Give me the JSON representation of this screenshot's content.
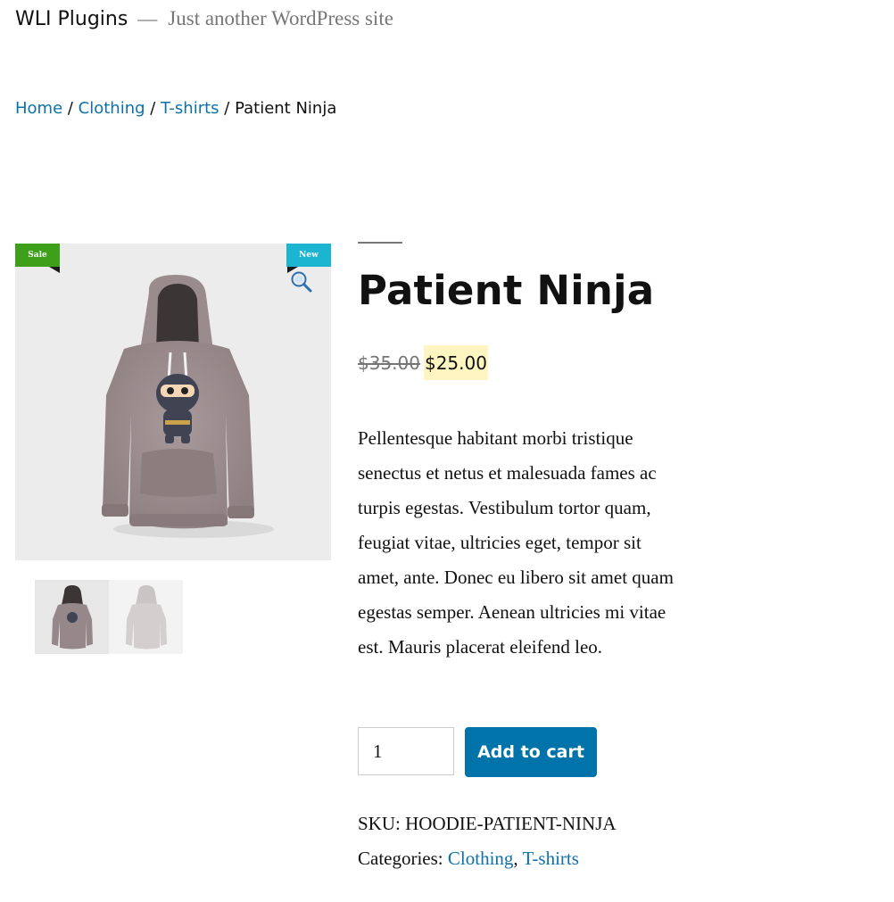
{
  "site": {
    "title": "WLI Plugins",
    "separator": "—",
    "tagline": "Just another WordPress site"
  },
  "breadcrumb": {
    "home": "Home",
    "sep1": " / ",
    "clothing": "Clothing",
    "sep2": " / ",
    "tshirts": "T-shirts",
    "sep3": " / ",
    "current": "Patient Ninja"
  },
  "gallery": {
    "badge_sale": "Sale",
    "badge_new": "New",
    "badge_sale_color": "#3d9f1a",
    "badge_new_color": "#1bb4d1",
    "zoom_icon": "search-zoom-icon",
    "thumbnails": [
      "hoodie-front-thumbnail",
      "hoodie-back-thumbnail"
    ]
  },
  "product": {
    "title": "Patient Ninja",
    "price_old": "$35.00",
    "price_new": "$25.00",
    "description": "Pellentesque habitant morbi tristique senectus et netus et malesuada fames ac turpis egestas. Vestibulum tortor quam, feugiat vitae, ultricies eget, tempor sit amet, ante. Donec eu libero sit amet quam egestas semper. Aenean ultricies mi vitae est. Mauris placerat eleifend leo.",
    "quantity": "1",
    "add_to_cart": "Add to cart",
    "sku_label": "SKU:",
    "sku": "HOODIE-PATIENT-NINJA",
    "categories_label": "Categories:",
    "category1": "Clothing",
    "category_sep": ", ",
    "category2": "T-shirts"
  },
  "colors": {
    "link": "#0e71a8",
    "button": "#0073aa",
    "price_highlight": "#fff5c1"
  }
}
